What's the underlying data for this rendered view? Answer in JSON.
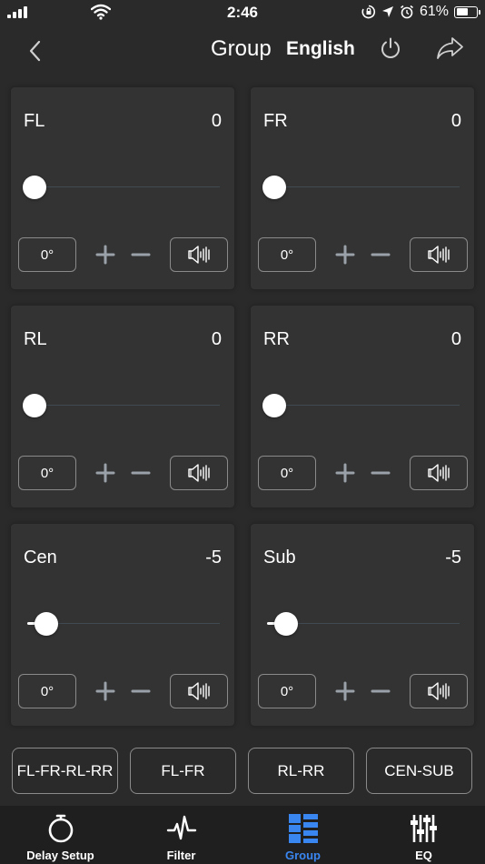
{
  "status_bar": {
    "time": "2:46",
    "battery": "61%"
  },
  "nav": {
    "title": "Group",
    "language": "English"
  },
  "channels": [
    {
      "name": "FL",
      "value": "0",
      "level": 0.0,
      "phase": "0°"
    },
    {
      "name": "FR",
      "value": "0",
      "level": 0.0,
      "phase": "0°"
    },
    {
      "name": "RL",
      "value": "0",
      "level": 0.0,
      "phase": "0°"
    },
    {
      "name": "RR",
      "value": "0",
      "level": 0.0,
      "phase": "0°"
    },
    {
      "name": "Cen",
      "value": "-5",
      "level": 0.07,
      "phase": "0°"
    },
    {
      "name": "Sub",
      "value": "-5",
      "level": 0.07,
      "phase": "0°"
    }
  ],
  "groups": [
    "FL-FR-RL-RR",
    "FL-FR",
    "RL-RR",
    "CEN-SUB"
  ],
  "tabs": [
    {
      "label": "Delay Setup",
      "icon": "stopwatch-icon"
    },
    {
      "label": "Filter",
      "icon": "waveform-icon"
    },
    {
      "label": "Group",
      "icon": "grid-icon"
    },
    {
      "label": "EQ",
      "icon": "sliders-icon"
    }
  ],
  "active_tab": 2,
  "colors": {
    "background": "#2a2a2a",
    "card": "#333333",
    "accent": "#3a86f0",
    "tab_bar": "#1f1f1f"
  }
}
